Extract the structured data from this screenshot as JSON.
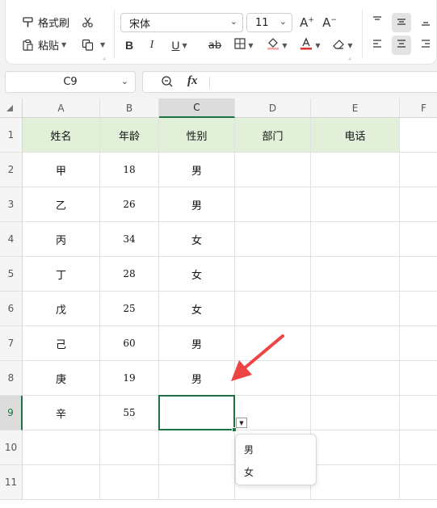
{
  "ribbon": {
    "format_painter": "格式刷",
    "paste": "粘贴",
    "font_name": "宋体",
    "font_size": "11",
    "bold": "B",
    "italic": "I",
    "underline": "U",
    "strikethrough": "ab",
    "increase_font": "A⁺",
    "decrease_font": "A⁻",
    "font_color": "#e03131"
  },
  "formula_bar": {
    "cell_ref": "C9",
    "fx_label": "fx",
    "formula": ""
  },
  "columns": [
    "A",
    "B",
    "C",
    "D",
    "E",
    "F"
  ],
  "rows": [
    "1",
    "2",
    "3",
    "4",
    "5",
    "6",
    "7",
    "8",
    "9",
    "10",
    "11"
  ],
  "sheet": {
    "headers": [
      "姓名",
      "年龄",
      "性别",
      "部门",
      "电话"
    ],
    "data": [
      [
        "甲",
        "18",
        "男"
      ],
      [
        "乙",
        "26",
        "男"
      ],
      [
        "丙",
        "34",
        "女"
      ],
      [
        "丁",
        "28",
        "女"
      ],
      [
        "戊",
        "25",
        "女"
      ],
      [
        "己",
        "60",
        "男"
      ],
      [
        "庚",
        "19",
        "男"
      ],
      [
        "辛",
        "55",
        ""
      ]
    ],
    "selected_cell": "C9",
    "header_fill": "#e2efd9",
    "accent": "#1e7145"
  },
  "dropdown": {
    "options": [
      "男",
      "女"
    ]
  },
  "annotation": {
    "arrow_color": "#ef4444"
  }
}
